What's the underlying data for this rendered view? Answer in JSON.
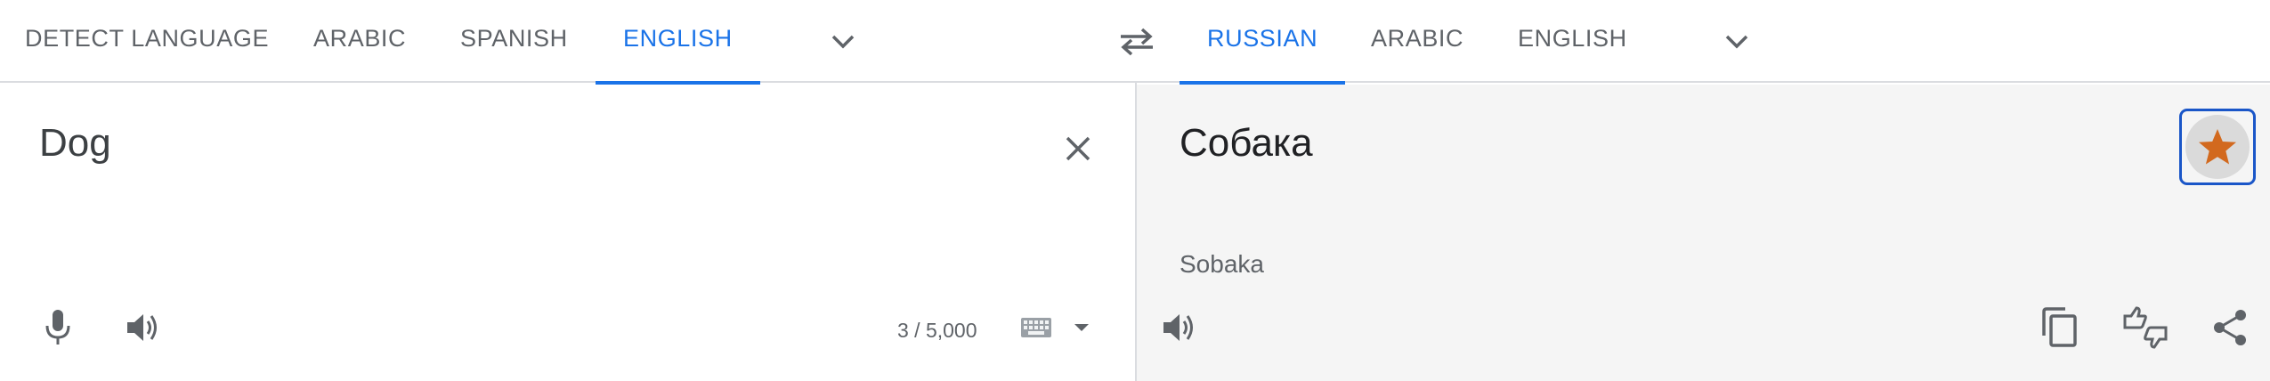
{
  "source_languages": {
    "tabs": [
      "DETECT LANGUAGE",
      "ARABIC",
      "SPANISH",
      "ENGLISH"
    ],
    "active_index": 3,
    "more_icon": "chevron-down-icon"
  },
  "swap_icon": "swap-arrows-icon",
  "target_languages": {
    "tabs": [
      "RUSSIAN",
      "ARABIC",
      "ENGLISH"
    ],
    "active_index": 0,
    "more_icon": "chevron-down-icon"
  },
  "source": {
    "text": "Dog",
    "char_count": "3 / 5,000",
    "icons": [
      "close-icon",
      "microphone-icon",
      "speaker-icon",
      "keyboard-icon",
      "dropdown-arrow-icon"
    ]
  },
  "translation": {
    "text": "Собака",
    "transliteration": "Sobaka",
    "icons": [
      "star-icon",
      "speaker-icon",
      "copy-icon",
      "feedback-icon",
      "share-icon"
    ]
  },
  "colors": {
    "accent": "#1a73e8",
    "star": "#d2691e",
    "star_bg": "#dadada",
    "star_focus_border": "#1a56c8",
    "icon": "#5f6368",
    "result_bg": "#f5f5f5",
    "divider": "#dadce0"
  }
}
